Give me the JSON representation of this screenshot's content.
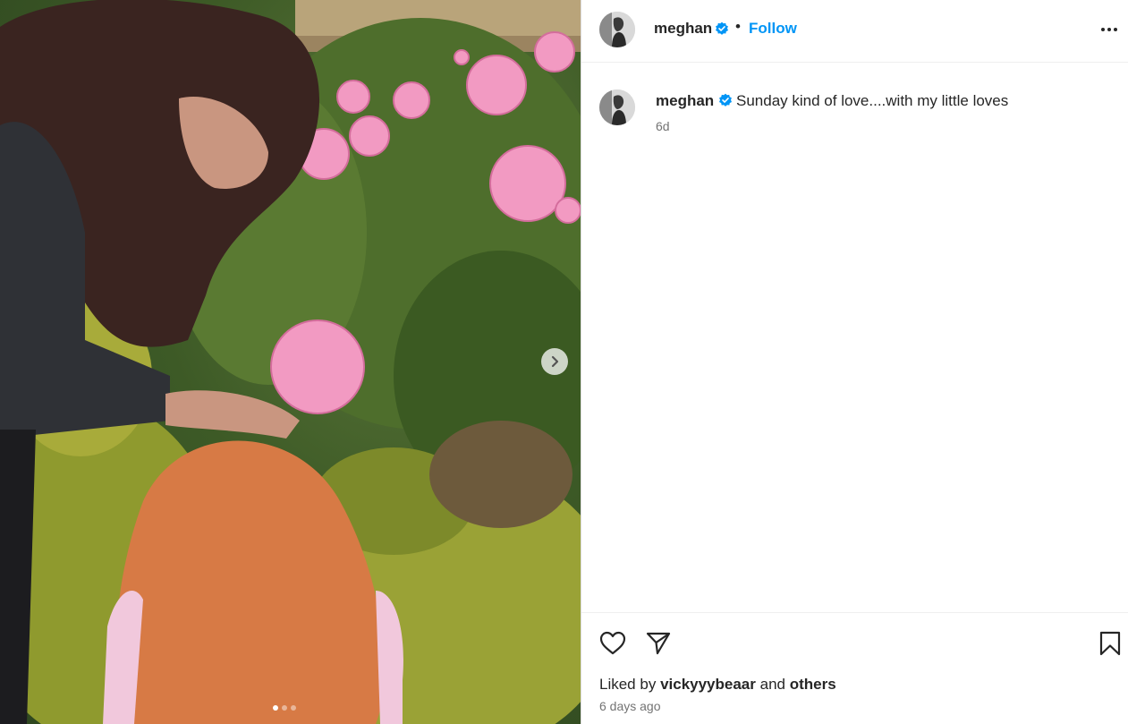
{
  "post": {
    "author": "meghan",
    "follow_label": "Follow",
    "separator": "•",
    "caption": "Sunday kind of love....with my little loves",
    "caption_age": "6d",
    "liked_by_prefix": "Liked by",
    "liked_by_user": "vickyyybeaar",
    "liked_by_and": "and",
    "liked_by_others": "others",
    "date_label": "6 days ago"
  },
  "carousel": {
    "slide_count": 3,
    "active_index": 0
  },
  "icons": {
    "verified": "verified-badge-icon",
    "more": "more-options-icon",
    "like": "heart-icon",
    "share": "paper-plane-icon",
    "save": "bookmark-icon",
    "next": "chevron-right-icon"
  },
  "colors": {
    "accent": "#0095f6",
    "verified": "#0095f6",
    "text": "#262626",
    "secondary_text": "#737373",
    "border": "#dbdbdb"
  }
}
